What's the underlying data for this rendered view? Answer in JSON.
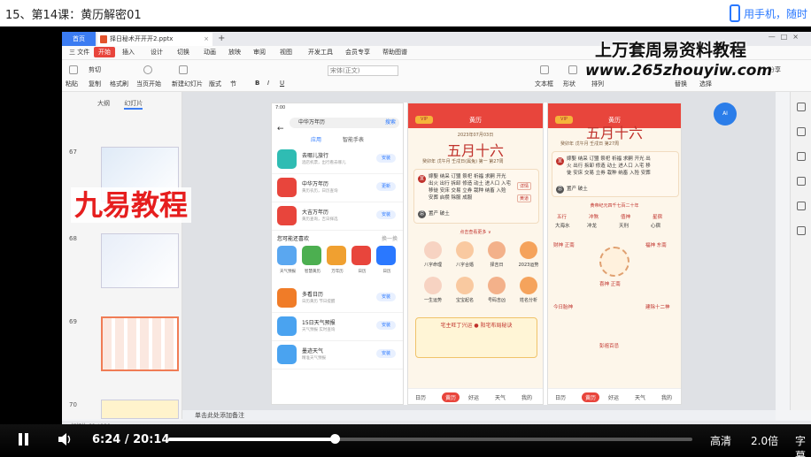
{
  "header": {
    "title": "15、第14课：黄历解密01",
    "mobile_text": "用手机，随时"
  },
  "wps": {
    "tab_home": "首页",
    "tab_doc": "择日秘术开开开2.pptx",
    "menu": [
      "三 文件",
      "开始",
      "插入",
      "设计",
      "切换",
      "动画",
      "放映",
      "审阅",
      "视图",
      "开发工具",
      "会员专享",
      "帮助图谱"
    ],
    "active_menu": "开始",
    "toolbar": {
      "paste": "粘贴",
      "cut": "剪切",
      "copy": "复制",
      "format": "格式刷",
      "from_start": "当页开始",
      "new_slide": "新建幻灯片",
      "layout": "版式",
      "section": "节",
      "font": "宋体(正文)",
      "textbox": "文本框",
      "shapes": "形状",
      "arrange": "排列",
      "replace": "替换",
      "select": "选择",
      "share": "分享"
    },
    "slidepanel": {
      "tabs": [
        "大纲",
        "幻灯片"
      ],
      "active_tab": "幻灯片",
      "nums": [
        "67",
        "68",
        "69",
        "70"
      ]
    },
    "notes": "单击此处添加备注",
    "status": "幻灯片 69 / 120"
  },
  "watermark": "九易教程",
  "overlay": {
    "title": "上万套周易资料教程",
    "url": "www.265zhouyiw.com"
  },
  "phone1": {
    "status": "7:00",
    "search": "中华万年历",
    "search_go": "搜索",
    "tabs": [
      "应用",
      "智能手表"
    ],
    "apps": [
      {
        "name": "去哪儿旅行",
        "desc": "酒店机票，出行看去哪儿",
        "btn": "安装",
        "color": "#2fbcb3"
      },
      {
        "name": "中华万年历",
        "desc": "黄历农历，日历查询",
        "btn": "更新",
        "color": "#e8453c"
      },
      {
        "name": "大吉万年历",
        "desc": "黄历查询，吉日择选",
        "btn": "安装",
        "color": "#e8453c"
      }
    ],
    "section": "您可能还喜欢",
    "section_more": "换一换",
    "grid": [
      {
        "l": "天气预报",
        "c": "#5aa7f0"
      },
      {
        "l": "智慧黄历",
        "c": "#4caf50"
      },
      {
        "l": "万年历",
        "c": "#f0a030"
      },
      {
        "l": "日历",
        "c": "#e8453c"
      },
      {
        "l": "日历",
        "c": "#2a78ff"
      }
    ],
    "apps2": [
      {
        "name": "多看日历",
        "desc": "日历黄历 节日提醒",
        "btn": "安装",
        "color": "#f07c28"
      },
      {
        "name": "15日天气预报",
        "desc": "天气预报 实时查询",
        "btn": "安装",
        "color": "#4aa3f0"
      },
      {
        "name": "墨迹天气",
        "desc": "精准天气预报",
        "btn": "安装",
        "color": "#4aa3f0"
      }
    ]
  },
  "phone2": {
    "title": "黄历",
    "badge": "VIP",
    "date_line": "2023年07月03日",
    "big": "五月十六",
    "sub": "癸卯年 戊午月 壬戌日(属兔) 第一 第27周",
    "yi_label": "宜",
    "ji_label": "忌",
    "yi": "嫁娶 纳采 订盟 祭祀 祈福 求嗣 开光 出火 出行 拆卸 修造 动土 进人口 入宅 移徙 安床 交易 立券 栽种 纳畜 入殓 安葬 启攒 除服 成服",
    "ji": "置产 破土",
    "chip1": "详情",
    "chip2": "黄道",
    "more": "点击查看更多 ∨",
    "icons": [
      "八字命理",
      "八字合婚",
      "择吉日",
      "2023运势",
      "一生运势",
      "宝宝起名",
      "号码吉凶",
      "姓名分析"
    ],
    "banner": "宅主旺丁兴运 ● 阳宅布局秘诀",
    "nav": [
      "日历",
      "黄历",
      "好运",
      "天气",
      "我的"
    ],
    "nav_sel": "黄历"
  },
  "phone3": {
    "title": "黄历",
    "badge": "VIP",
    "big": "五月十六",
    "sub": "癸卯年 戊午月 壬戌日 第27周",
    "yi_label": "宜",
    "ji_label": "忌",
    "yi": "嫁娶 纳采 订盟 祭祀 祈福 求嗣 开光 出火 出行 拆卸 修造 动土 进人口 入宅 移徙 安床 交易 立券 栽种 纳畜 入殓 安葬",
    "ji": "置产 破土",
    "era": "黄帝纪元四千七百二十年",
    "wuxing": [
      "五行",
      "冲煞",
      "值神",
      "星宿"
    ],
    "wuxing_v": [
      "大海水",
      "冲龙",
      "天刑",
      "心宿"
    ],
    "labels": [
      "财神 正南",
      "喜神 正南",
      "福神 东南",
      "今日胎神",
      "彭祖百忌",
      "建除十二神"
    ],
    "nav": [
      "日历",
      "黄历",
      "好运",
      "天气",
      "我的"
    ],
    "nav_sel": "黄历"
  },
  "player": {
    "time": "6:24 / 20:14",
    "progress_pct": 31.7,
    "quality": "高清",
    "speed": "2.0倍",
    "subtitle": "字幕"
  }
}
